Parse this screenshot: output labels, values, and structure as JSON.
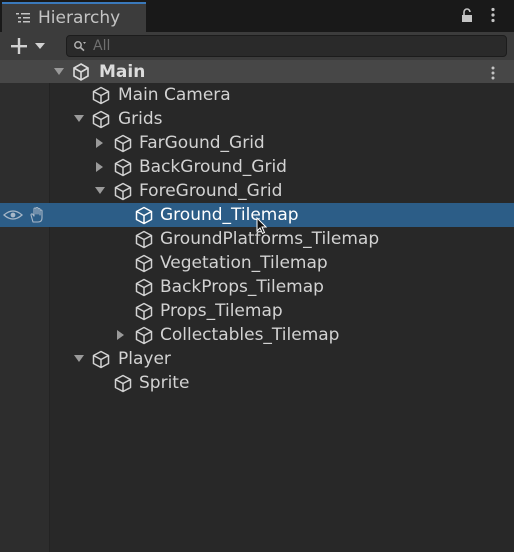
{
  "window": {
    "tab_title": "Hierarchy",
    "tab_icon": "hierarchy-list-icon"
  },
  "toolbar": {
    "add_icon": "plus-icon",
    "dropdown_icon": "chevron-down-icon",
    "search_placeholder": "All",
    "search_value": ""
  },
  "scene": {
    "name": "Main",
    "icon": "unity-scene-icon"
  },
  "items": [
    {
      "label": "Main Camera",
      "icon": "cube-icon"
    },
    {
      "label": "Grids",
      "icon": "cube-icon",
      "expanded": true
    },
    {
      "label": "FarGound_Grid",
      "icon": "cube-icon",
      "expanded": false
    },
    {
      "label": "BackGround_Grid",
      "icon": "cube-icon",
      "expanded": false
    },
    {
      "label": "ForeGround_Grid",
      "icon": "cube-icon",
      "expanded": true
    },
    {
      "label": "Ground_Tilemap",
      "icon": "cube-icon",
      "selected": true
    },
    {
      "label": "GroundPlatforms_Tilemap",
      "icon": "cube-icon"
    },
    {
      "label": "Vegetation_Tilemap",
      "icon": "cube-icon"
    },
    {
      "label": "BackProps_Tilemap",
      "icon": "cube-icon"
    },
    {
      "label": "Props_Tilemap",
      "icon": "cube-icon"
    },
    {
      "label": "Collectables_Tilemap",
      "icon": "cube-icon",
      "expanded": false
    },
    {
      "label": "Player",
      "icon": "cube-icon",
      "expanded": true
    },
    {
      "label": "Sprite",
      "icon": "cube-icon"
    }
  ],
  "colors": {
    "selection": "#2c5d87",
    "tab_accent": "#3a79bb",
    "background": "#282828"
  }
}
